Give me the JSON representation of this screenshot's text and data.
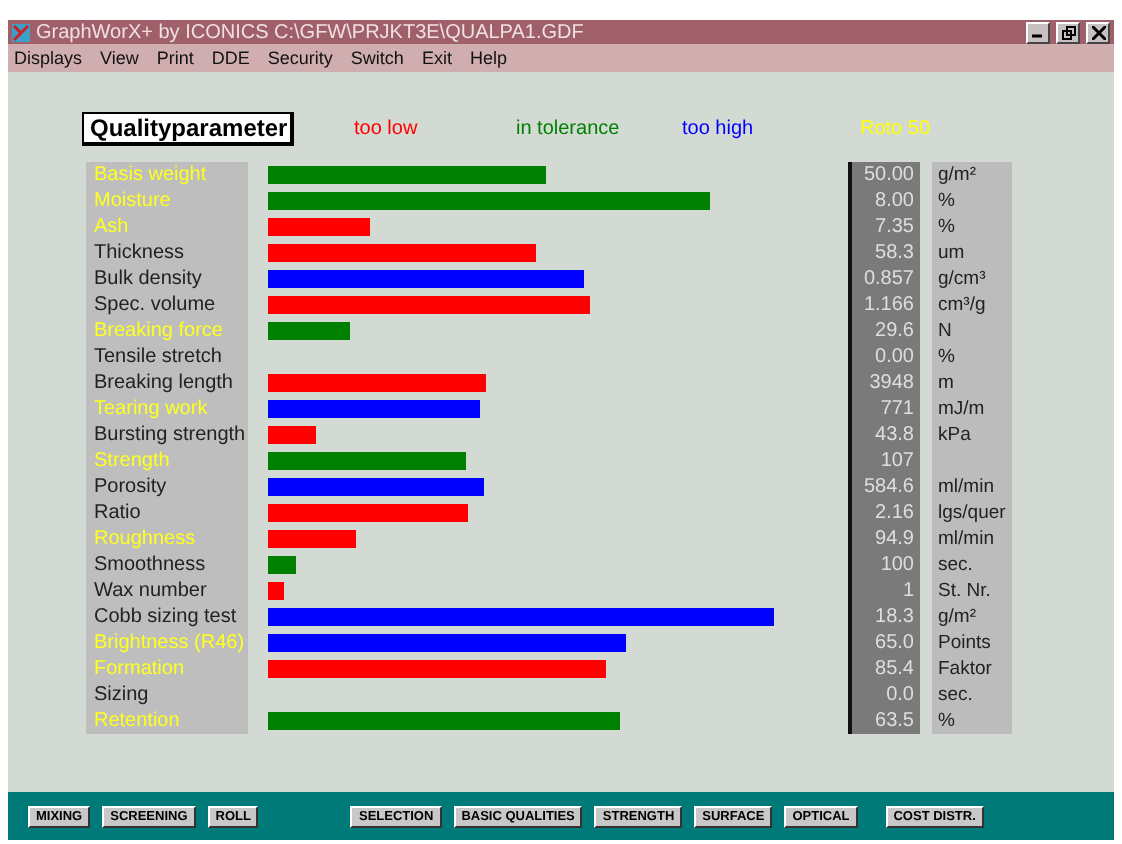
{
  "window": {
    "title": "GraphWorX+ by ICONICS  C:\\GFW\\PRJKT3E\\QUALPA1.GDF"
  },
  "menu": [
    "Displays",
    "View",
    "Print",
    "DDE",
    "Security",
    "Switch",
    "Exit",
    "Help"
  ],
  "header": {
    "title": "Qualityparameter"
  },
  "legend": [
    {
      "label": "too low",
      "color": "#ff0000"
    },
    {
      "label": "in tolerance",
      "color": "#008000"
    },
    {
      "label": "too high",
      "color": "#0000ff"
    },
    {
      "label": "Roto 50",
      "color": "#ffff00"
    }
  ],
  "rows": [
    {
      "name": "Basis weight",
      "roto": true,
      "color": "#008000",
      "value": "50.00",
      "unit": "g/m²"
    },
    {
      "name": "Moisture",
      "roto": true,
      "color": "#008000",
      "value": "8.00",
      "unit": "%"
    },
    {
      "name": "Ash",
      "roto": true,
      "color": "#ff0000",
      "value": "7.35",
      "unit": "%"
    },
    {
      "name": "Thickness",
      "roto": false,
      "color": "#ff0000",
      "value": "58.3",
      "unit": "um"
    },
    {
      "name": "Bulk density",
      "roto": false,
      "color": "#0000ff",
      "value": "0.857",
      "unit": "g/cm³"
    },
    {
      "name": "Spec. volume",
      "roto": false,
      "color": "#ff0000",
      "value": "1.166",
      "unit": "cm³/g"
    },
    {
      "name": "Breaking force",
      "roto": true,
      "color": "#008000",
      "value": "29.6",
      "unit": "N"
    },
    {
      "name": "Tensile stretch",
      "roto": false,
      "value": "0.00",
      "unit": "%"
    },
    {
      "name": "Breaking length",
      "roto": false,
      "color": "#ff0000",
      "value": "3948",
      "unit": "m"
    },
    {
      "name": "Tearing work",
      "roto": true,
      "color": "#0000ff",
      "value": "771",
      "unit": "mJ/m"
    },
    {
      "name": "Bursting strength",
      "roto": false,
      "color": "#ff0000",
      "value": "43.8",
      "unit": "kPa"
    },
    {
      "name": "Strength",
      "roto": true,
      "color": "#008000",
      "value": "107"
    },
    {
      "name": "Porosity",
      "roto": false,
      "color": "#0000ff",
      "value": "584.6",
      "unit": "ml/min"
    },
    {
      "name": "Ratio",
      "roto": false,
      "color": "#ff0000",
      "value": "2.16",
      "unit": "lgs/quer"
    },
    {
      "name": "Roughness",
      "roto": true,
      "color": "#ff0000",
      "value": "94.9",
      "unit": "ml/min"
    },
    {
      "name": "Smoothness",
      "roto": false,
      "color": "#008000",
      "value": "100",
      "unit": "sec."
    },
    {
      "name": "Wax number",
      "roto": false,
      "color": "#ff0000",
      "value": "1",
      "unit": "St. Nr."
    },
    {
      "name": "Cobb sizing test",
      "roto": false,
      "color": "#0000ff",
      "value": "18.3",
      "unit": "g/m²"
    },
    {
      "name": "Brightness (R46)",
      "roto": true,
      "color": "#0000ff",
      "value": "65.0",
      "unit": "Points"
    },
    {
      "name": "Formation",
      "roto": true,
      "color": "#ff0000",
      "value": "85.4",
      "unit": "Faktor"
    },
    {
      "name": "Sizing",
      "roto": false,
      "value": "0.0",
      "unit": "sec."
    },
    {
      "name": "Retention",
      "roto": true,
      "color": "#008000",
      "value": "63.5",
      "unit": "%"
    }
  ],
  "buttons": [
    "MIXING",
    "SCREENING",
    "ROLL",
    "SELECTION",
    "BASIC QUALITIES",
    "STRENGTH",
    "SURFACE",
    "OPTICAL",
    "COST DISTR."
  ]
}
